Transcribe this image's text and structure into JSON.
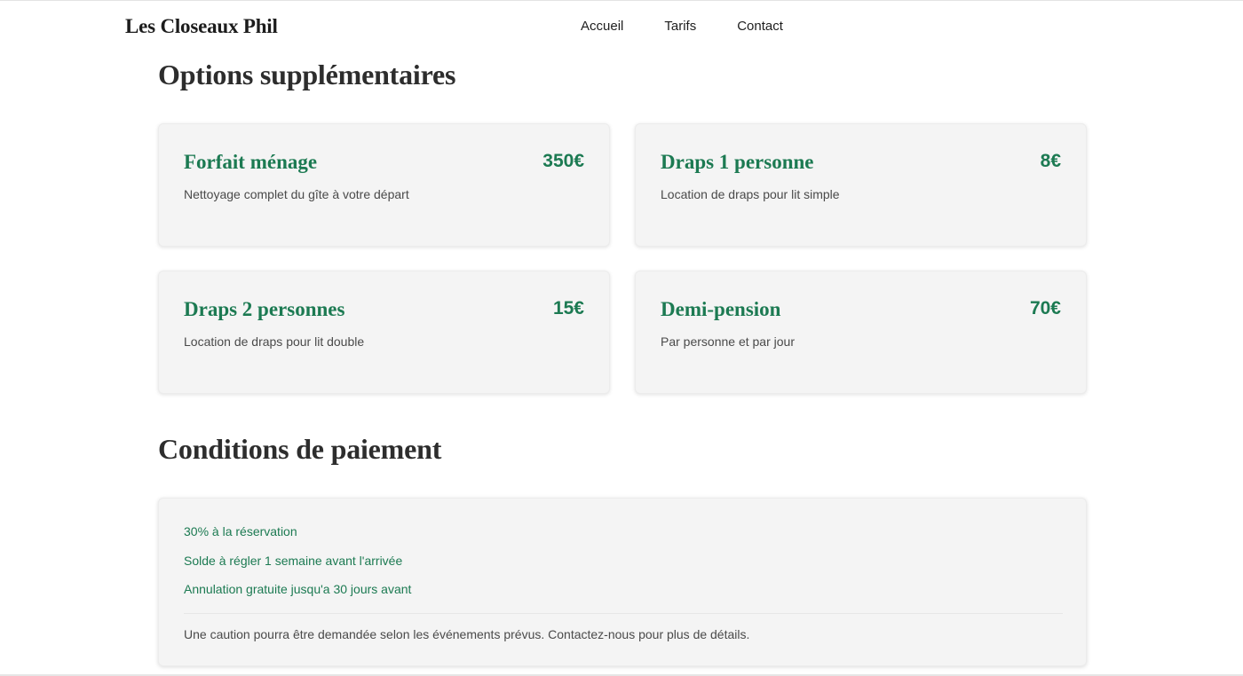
{
  "header": {
    "brand": "Les Closeaux Phil",
    "nav": [
      "Accueil",
      "Tarifs",
      "Contact"
    ]
  },
  "options": {
    "title": "Options supplémentaires",
    "items": [
      {
        "name": "Forfait ménage",
        "price": "350€",
        "description": "Nettoyage complet du gîte à votre départ"
      },
      {
        "name": "Draps 1 personne",
        "price": "8€",
        "description": "Location de draps pour lit simple"
      },
      {
        "name": "Draps 2 personnes",
        "price": "15€",
        "description": "Location de draps pour lit double"
      },
      {
        "name": "Demi-pension",
        "price": "70€",
        "description": "Par personne et par jour"
      }
    ]
  },
  "conditions": {
    "title": "Conditions de paiement",
    "items": [
      "30% à la réservation",
      "Solde à régler 1 semaine avant l'arrivée",
      "Annulation gratuite jusqu'a 30 jours avant"
    ],
    "note": "Une caution pourra être demandée selon les événements prévus. Contactez-nous pour plus de détails."
  },
  "colors": {
    "accent": "#1c7a52",
    "card_background": "#f4f4f4",
    "heading": "#2d2d2d"
  }
}
